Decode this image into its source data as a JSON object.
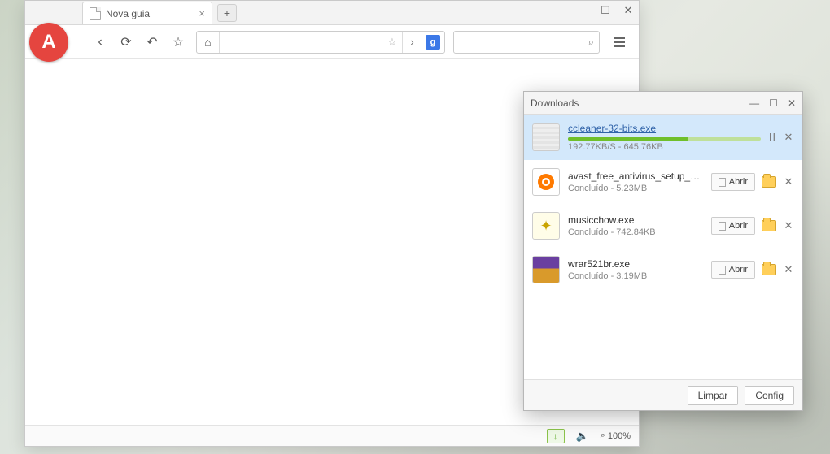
{
  "browser": {
    "tab_title": "Nova guia",
    "window_controls": {
      "min": "—",
      "max": "☐",
      "close": "✕"
    },
    "toolbar": {
      "back": "‹",
      "reload": "⟳",
      "undo": "↶",
      "bookmark": "☆",
      "home": "⌂",
      "go": "›",
      "google_badge": "g",
      "search_icon": "⌕",
      "address_value": "",
      "search_value": ""
    },
    "status": {
      "download_arrow": "↓",
      "volume_icon": "🔈",
      "zoom_icon": "⌕",
      "zoom_text": "100%"
    },
    "logo_letter": "A"
  },
  "downloads": {
    "title": "Downloads",
    "window_controls": {
      "min": "—",
      "max": "☐",
      "close": "✕"
    },
    "open_label": "Abrir",
    "footer": {
      "clear": "Limpar",
      "config": "Config"
    },
    "items": [
      {
        "name": "ccleaner-32-bits.exe",
        "sub": "192.77KB/S - 645.76KB",
        "state": "downloading",
        "progress_pct": 62
      },
      {
        "name": "avast_free_antivirus_setup_o...",
        "sub": "Concluído - 5.23MB",
        "state": "done",
        "thumb": "avast"
      },
      {
        "name": "musicchow.exe",
        "sub": "Concluído - 742.84KB",
        "state": "done",
        "thumb": "music"
      },
      {
        "name": "wrar521br.exe",
        "sub": "Concluído - 3.19MB",
        "state": "done",
        "thumb": "wrar"
      }
    ]
  }
}
